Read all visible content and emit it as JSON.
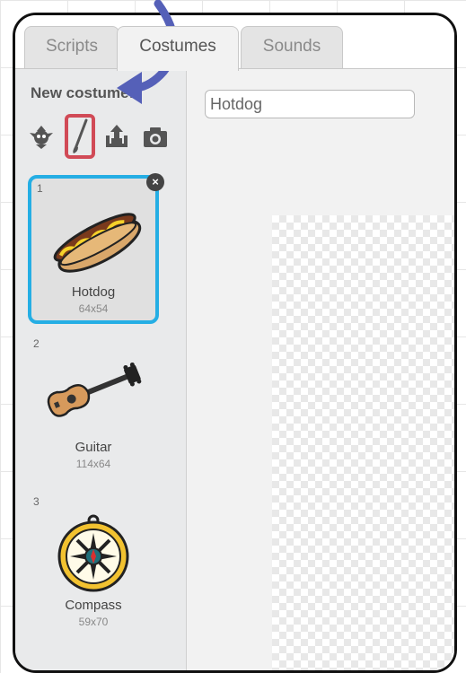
{
  "tabs": [
    {
      "label": "Scripts",
      "active": false
    },
    {
      "label": "Costumes",
      "active": true
    },
    {
      "label": "Sounds",
      "active": false
    }
  ],
  "sidebar": {
    "new_costume_label": "New costume:",
    "tools": [
      {
        "icon": "sprite-library-icon"
      },
      {
        "icon": "paintbrush-icon",
        "highlighted": true
      },
      {
        "icon": "upload-icon"
      },
      {
        "icon": "camera-icon"
      }
    ],
    "costumes": [
      {
        "number": "1",
        "name": "Hotdog",
        "size": "64x54",
        "selected": true
      },
      {
        "number": "2",
        "name": "Guitar",
        "size": "114x64",
        "selected": false
      },
      {
        "number": "3",
        "name": "Compass",
        "size": "59x70",
        "selected": false
      }
    ]
  },
  "editor": {
    "costume_name_value": "Hotdog"
  },
  "colors": {
    "selection": "#25aee4",
    "highlight": "#d14a56",
    "annotation_arrow": "#5560b8"
  }
}
